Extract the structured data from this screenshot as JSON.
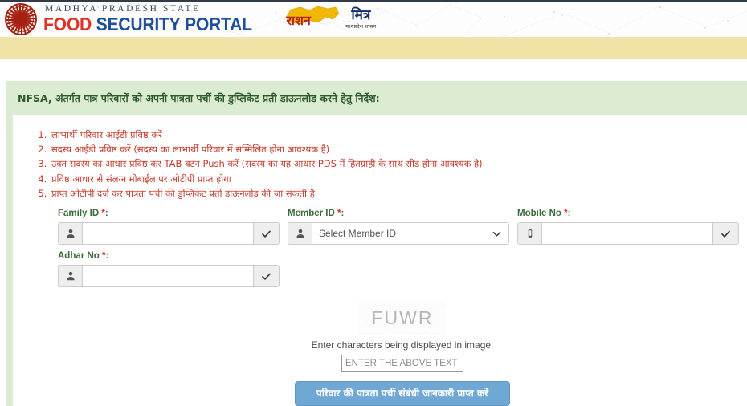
{
  "header": {
    "emblem_label": "MP",
    "title_top": "MADHYA PRADESH STATE",
    "title_food": "FOOD",
    "title_security": "SECURITY",
    "title_portal": "PORTAL",
    "ration_logo_word": "राशन",
    "mitra_word": "मित्र",
    "mitra_sub": "मध्यप्रदेश शासन",
    "band_color": "#f1e3a5"
  },
  "panel": {
    "heading": "NFSA, अंतर्गत पात्र परिवारों को अपनी पात्रता पर्ची की डुप्लिकेट प्रती डाऊनलोड करने हेतु निर्देश:",
    "heading_color": "#2e5b2e",
    "background_color": "#dcecd2",
    "instructions": [
      "लाभार्थी परिवार आईडी प्रविष्ठ करें",
      "सदस्य आईडी प्रविष्ठ करें (सदस्य का लाभार्थी परिवार में सम्मिलित होना आवश्यक है)",
      "उक्त सदस्य का आधार प्रविष्ठ कर TAB बटन Push करें (सदस्य का यह आधार PDS में हितग्राही के साथ सीड होना आवश्यक है)",
      "प्रविष्ठ आधार से संलग्न मोबाईल पर ओटीपी प्राप्त होगा",
      "प्राप्त ओटीपी दर्ज कर पात्रता पर्ची की डुप्लिकेट प्रती डाऊनलोड की जा सकती है"
    ],
    "instructions_color": "#c0392b"
  },
  "form": {
    "fields": [
      {
        "id": "family-id",
        "label": "Family ID ",
        "required_mark": "*",
        "suffix_colon": ":",
        "value": "",
        "placeholder": "",
        "prefix_icon": "user-icon",
        "suffix_icon": "check-icon"
      },
      {
        "id": "member-id",
        "label": "Member ID ",
        "required_mark": "*",
        "suffix_colon": ":",
        "value": "Select Member ID",
        "placeholder": "Select Member ID",
        "prefix_icon": "user-icon",
        "suffix_icon": "chevron-down-icon",
        "options": [
          "Select Member ID"
        ]
      },
      {
        "id": "mobile-no",
        "label": "Mobile No ",
        "required_mark": "*",
        "suffix_colon": ":",
        "value": "",
        "placeholder": "",
        "prefix_icon": "mobile-icon",
        "suffix_icon": "check-icon"
      },
      {
        "id": "adhar-no",
        "label": "Adhar No ",
        "required_mark": "*",
        "suffix_colon": ":",
        "value": "",
        "placeholder": "",
        "prefix_icon": "user-icon",
        "suffix_icon": "check-icon"
      }
    ]
  },
  "captcha": {
    "image_text": "FUWR",
    "hint": "Enter characters being displayed in image.",
    "input_value": "",
    "input_placeholder": "ENTER THE ABOVE TEXT HERE"
  },
  "submit": {
    "label": "परिवार की पात्रता पर्ची संबंधी जानकारी प्राप्त करें",
    "color": "#6fa8d4"
  }
}
